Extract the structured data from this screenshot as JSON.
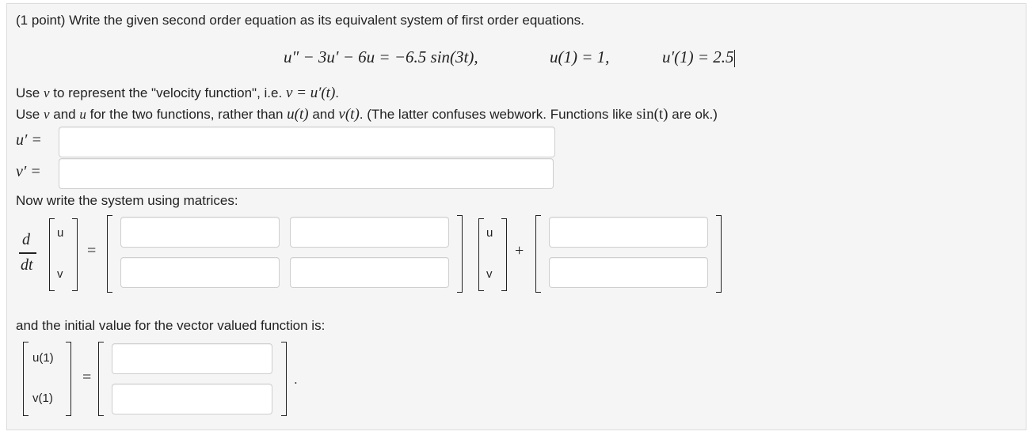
{
  "problem": {
    "intro": "(1 point) Write the given second order equation as its equivalent system of first order equations.",
    "equation": "u″ − 3u′ − 6u = −6.5 sin(3t),",
    "ic1": "u(1) = 1,",
    "ic2": "u′(1) = 2.5"
  },
  "instructions": {
    "line1_a": "Use",
    "line1_var": "v",
    "line1_b": "to represent the \"velocity function\", i.e.",
    "line1_math": "v = u′(t)",
    "line1_end": ".",
    "line2_a": "Use",
    "line2_v": "v",
    "line2_and": "and",
    "line2_u": "u",
    "line2_b": "for the two functions, rather than",
    "line2_ut": "u(t)",
    "line2_and2": "and",
    "line2_vt": "v(t)",
    "line2_c": ". (The latter confuses webwork. Functions like",
    "line2_sin": "sin(t)",
    "line2_d": "are ok.)"
  },
  "answers": {
    "uprime_label": "u′ =",
    "vprime_label": "v′ =",
    "uprime_value": "",
    "vprime_value": ""
  },
  "matrix_section": {
    "prompt": "Now write the system using matrices:",
    "d": "d",
    "dt": "dt",
    "vec_u": "u",
    "vec_v": "v",
    "equals": "=",
    "plus": "+",
    "entries": [
      "",
      "",
      "",
      "",
      "",
      ""
    ]
  },
  "initial_section": {
    "prompt": "and the initial value for the vector valued function is:",
    "u1": "u(1)",
    "v1": "v(1)",
    "equals": "=",
    "period": ".",
    "entries": [
      "",
      ""
    ]
  }
}
